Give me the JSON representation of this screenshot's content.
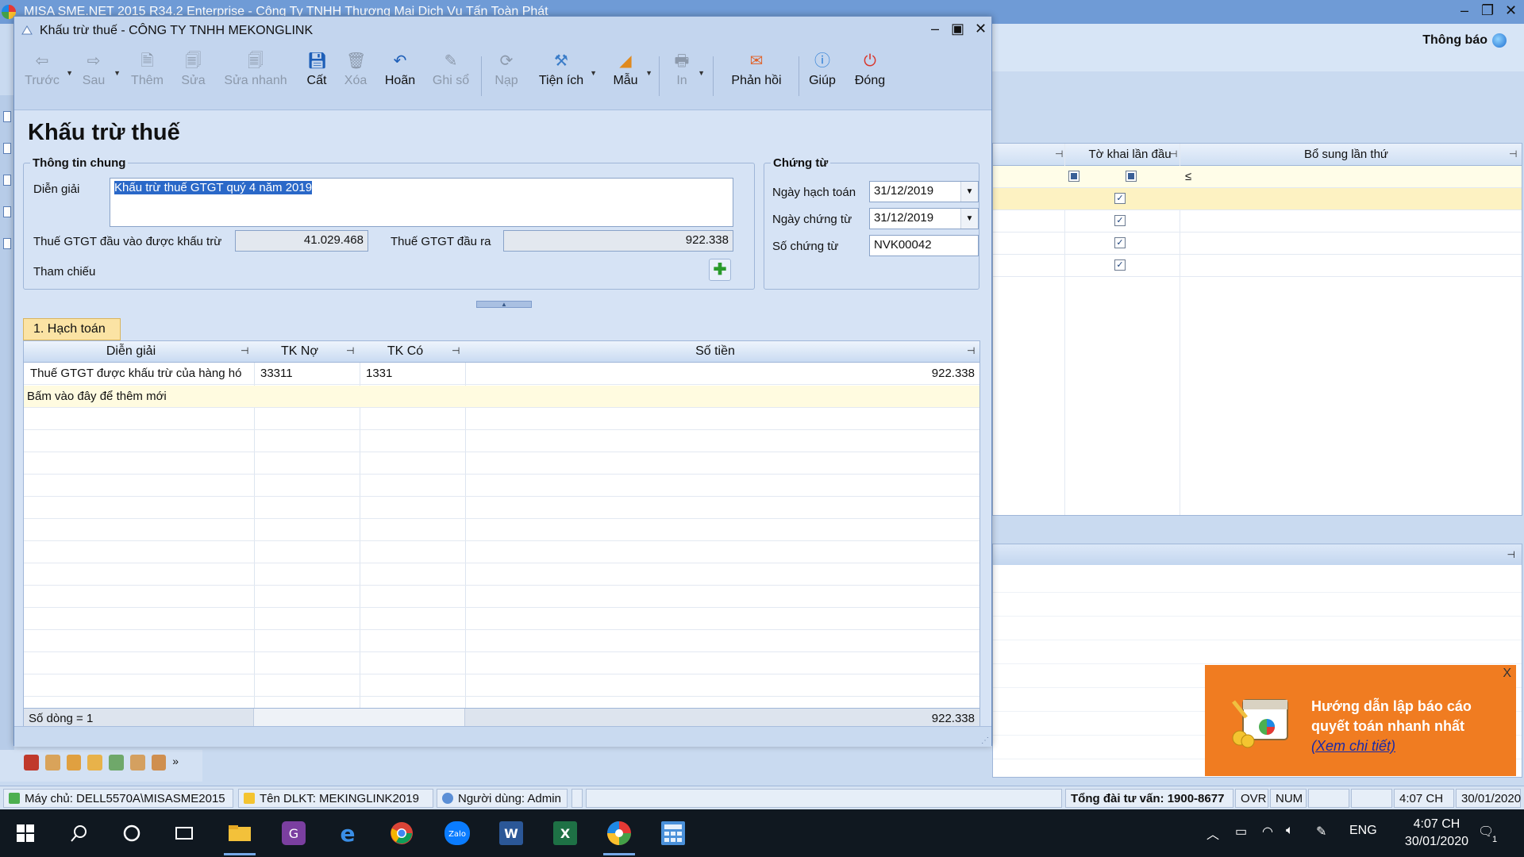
{
  "main_window": {
    "title": "MISA SME.NET 2015 R34.2 Enterprise - Công Ty TNHH Thương Mại Dịch Vụ Tấn Toàn Phát",
    "notification_label": "Thông báo",
    "bg_grid_headers": [
      "Tờ khai lần đầu",
      "Bổ sung lần thứ"
    ],
    "bg_grid_first_row_symbol": "≤"
  },
  "dialog": {
    "title": "Khấu trừ thuế - CÔNG TY TNHH MEKONGLINK",
    "heading": "Khấu trừ thuế",
    "toolbar": [
      {
        "label": "Trước",
        "icon": "arrow-left-icon",
        "disabled": true,
        "dropdown": true
      },
      {
        "label": "Sau",
        "icon": "arrow-right-icon",
        "disabled": true,
        "dropdown": true
      },
      {
        "label": "Thêm",
        "icon": "add-document-icon",
        "disabled": true
      },
      {
        "label": "Sửa",
        "icon": "edit-document-icon",
        "disabled": true
      },
      {
        "label": "Sửa nhanh",
        "icon": "quick-edit-icon",
        "disabled": true
      },
      {
        "label": "Cất",
        "icon": "save-icon",
        "disabled": false
      },
      {
        "label": "Xóa",
        "icon": "delete-icon",
        "disabled": true
      },
      {
        "label": "Hoãn",
        "icon": "undo-icon",
        "disabled": false
      },
      {
        "label": "Ghi sổ",
        "icon": "post-icon",
        "disabled": true
      },
      {
        "label": "Nạp",
        "icon": "reload-icon",
        "disabled": true
      },
      {
        "label": "Tiện ích",
        "icon": "tools-icon",
        "disabled": false,
        "dropdown": true
      },
      {
        "label": "Mẫu",
        "icon": "template-icon",
        "disabled": false,
        "dropdown": true
      },
      {
        "label": "In",
        "icon": "print-icon",
        "disabled": true,
        "dropdown": true
      },
      {
        "label": "Phản hồi",
        "icon": "feedback-mail-icon",
        "disabled": false
      },
      {
        "label": "Giúp",
        "icon": "help-icon",
        "disabled": false
      },
      {
        "label": "Đóng",
        "icon": "close-power-icon",
        "disabled": false
      }
    ],
    "general": {
      "legend": "Thông tin chung",
      "description_label": "Diễn giải",
      "description_value": "Khấu trừ thuế GTGT quý 4 năm 2019",
      "input_vat_label": "Thuế GTGT đầu vào được khấu trừ",
      "input_vat_value": "41.029.468",
      "output_vat_label": "Thuế GTGT đầu ra",
      "output_vat_value": "922.338",
      "reference_label": "Tham chiếu"
    },
    "voucher": {
      "legend": "Chứng từ",
      "posting_date_label": "Ngày hạch toán",
      "posting_date_value": "31/12/2019",
      "voucher_date_label": "Ngày chứng từ",
      "voucher_date_value": "31/12/2019",
      "voucher_no_label": "Số chứng từ",
      "voucher_no_value": "NVK00042"
    },
    "tab_label": "1. Hạch toán",
    "grid": {
      "columns": [
        "Diễn giải",
        "TK Nợ",
        "TK Có",
        "Số tiền"
      ],
      "rows": [
        {
          "description": "Thuế GTGT được khấu trừ của hàng hó",
          "debit": "33311",
          "credit": "1331",
          "amount": "922.338"
        }
      ],
      "new_row_hint": "Bấm vào đây để thêm mới",
      "row_count": "Số dòng = 1",
      "total": "922.338"
    }
  },
  "notification_popup": {
    "close": "X",
    "line1": "Hướng dẫn lập báo cáo",
    "line2": "quyết toán nhanh nhất",
    "link": "(Xem chi tiết)"
  },
  "statusbar": {
    "server": "Máy chủ: DELL5570A\\MISASME2015",
    "database": "Tên DLKT: MEKINGLINK2019",
    "user": "Người dùng: Admin",
    "hotline": "Tổng đài tư vấn: 1900-8677",
    "ovr": "OVR",
    "num": "NUM",
    "time": "4:07 CH",
    "date": "30/01/2020"
  },
  "taskbar": {
    "language": "ENG",
    "clock_time": "4:07 CH",
    "clock_date": "30/01/2020",
    "notification_count": "1",
    "apps": [
      "start-icon",
      "search-icon",
      "cortana-icon",
      "task-view-icon",
      "file-explorer-icon",
      "pdf-app-icon",
      "edge-icon",
      "chrome-icon",
      "zalo-icon",
      "word-icon",
      "excel-icon",
      "misa-icon",
      "calculator-icon"
    ]
  },
  "colors": {
    "notification_bg": "#f07c21",
    "tab_active": "#fbe3a4",
    "selection": "#2a68c8"
  }
}
